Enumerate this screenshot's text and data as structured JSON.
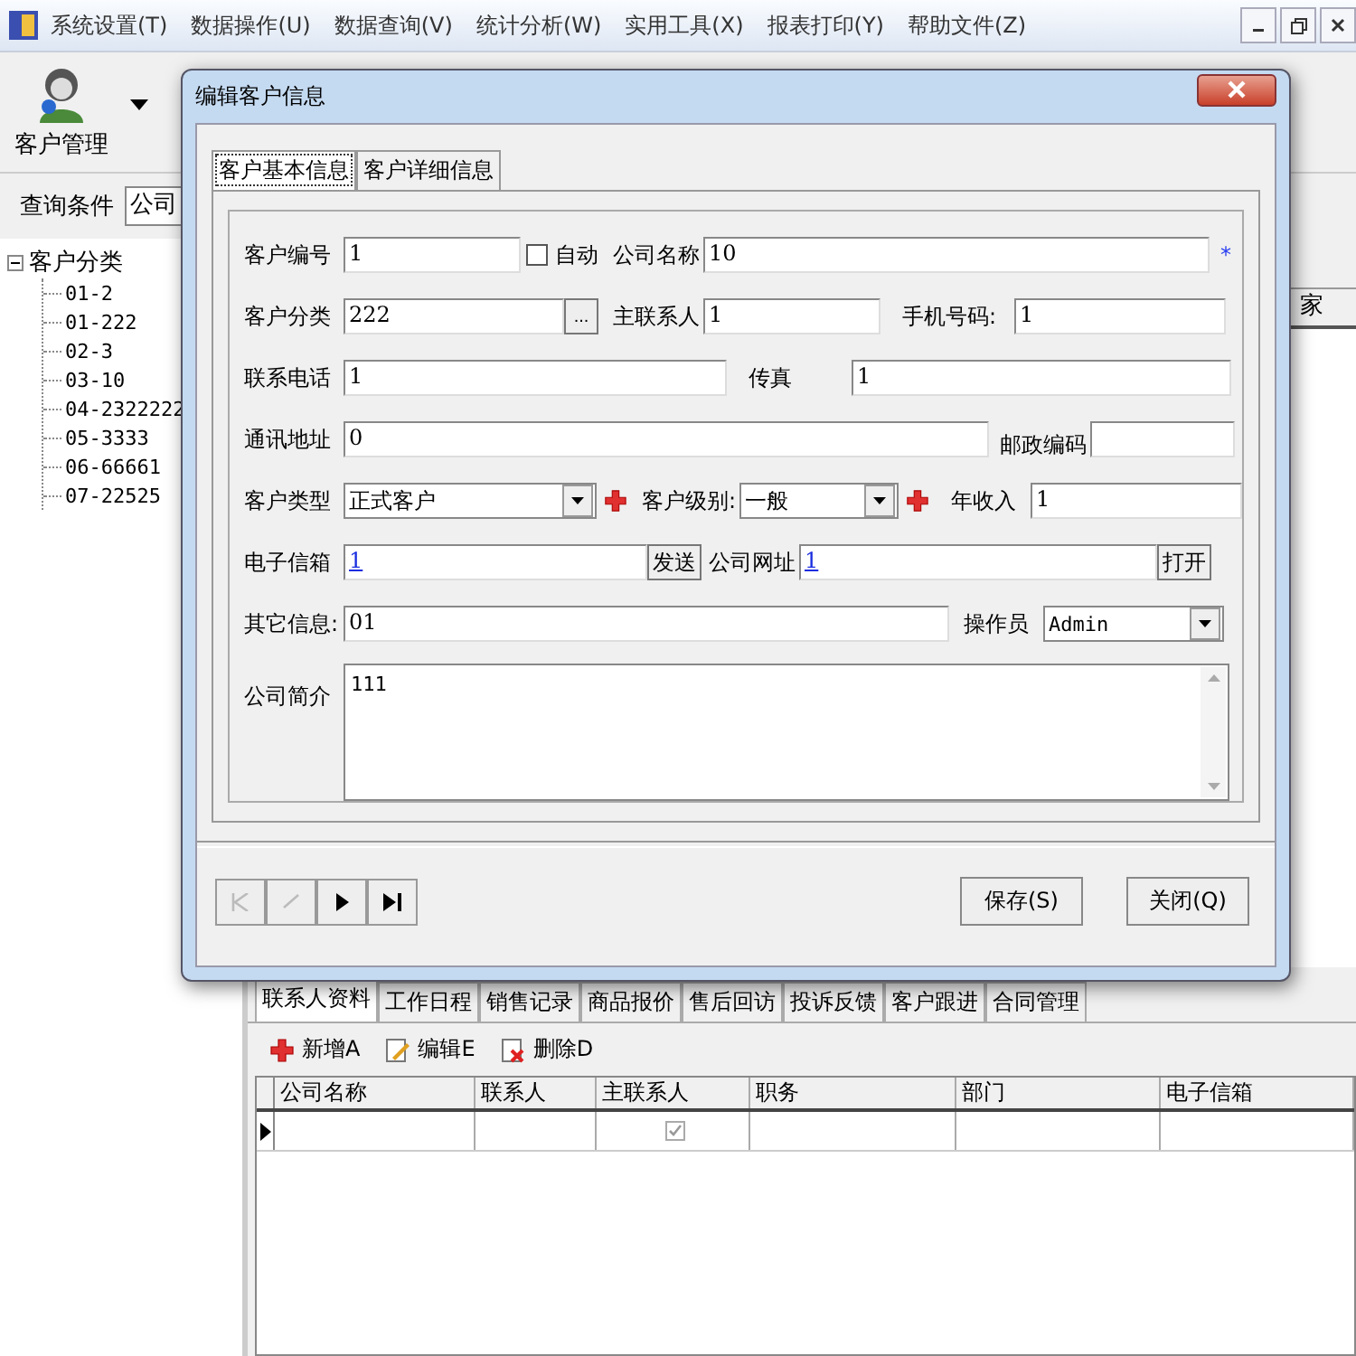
{
  "menu_bar": {
    "items": [
      "系统设置(T)",
      "数据操作(U)",
      "数据查询(V)",
      "统计分析(W)",
      "实用工具(X)",
      "报表打印(Y)",
      "帮助文件(Z)"
    ]
  },
  "toolbar": {
    "items": [
      {
        "label": "客户管理"
      }
    ]
  },
  "query": {
    "label": "查询条件",
    "value": "公司"
  },
  "tree": {
    "label": "客户分类",
    "expanded": true,
    "children": [
      {
        "label": "01-2"
      },
      {
        "label": "01-222"
      },
      {
        "label": "02-3"
      },
      {
        "label": "03-10"
      },
      {
        "label": "04-2322222"
      },
      {
        "label": "05-3333"
      },
      {
        "label": "06-66661"
      },
      {
        "label": "07-22525"
      }
    ]
  },
  "main_grid": {
    "columns": [
      "家"
    ]
  },
  "dialog": {
    "title": "编辑客户信息",
    "tabs": [
      {
        "label": "客户基本信息",
        "selected": true
      },
      {
        "label": "客户详细信息",
        "selected": false
      }
    ],
    "form": {
      "customer_no": {
        "label": "客户编号",
        "value": "1"
      },
      "auto": {
        "label": "自动",
        "checked": false
      },
      "company_name": {
        "label": "公司名称",
        "value": "10",
        "required_mark": "*"
      },
      "category": {
        "label": "客户分类",
        "value": "222",
        "button": "..."
      },
      "main_contact": {
        "label": "主联系人",
        "value": "1"
      },
      "mobile": {
        "label": "手机号码:",
        "value": "1"
      },
      "phone": {
        "label": "联系电话",
        "value": "1"
      },
      "fax": {
        "label": "传真",
        "value": "1"
      },
      "address": {
        "label": "通讯地址",
        "value": "0"
      },
      "postcode": {
        "label": "邮政编码"
      },
      "customer_type": {
        "label": "客户类型",
        "value": "正式客户"
      },
      "level": {
        "label": "客户级别:",
        "value": "一般"
      },
      "income": {
        "label": "年收入",
        "value": "1"
      },
      "email": {
        "label": "电子信箱",
        "value": "1",
        "button": "发送"
      },
      "website": {
        "label": "公司网址",
        "value": "1",
        "button": "打开"
      },
      "other": {
        "label": "其它信息:",
        "value": "01"
      },
      "operator": {
        "label": "操作员",
        "value": "Admin"
      },
      "intro": {
        "label": "公司简介",
        "value": "111"
      }
    },
    "nav_buttons": [
      {
        "kind": "first",
        "disabled": true
      },
      {
        "kind": "prev",
        "disabled": true
      },
      {
        "kind": "next",
        "disabled": false
      },
      {
        "kind": "last",
        "disabled": false
      }
    ],
    "buttons": [
      "保存(S)",
      "关闭(Q)"
    ]
  },
  "bottom": {
    "tabs": [
      {
        "label": "联系人资料",
        "selected": true
      },
      {
        "label": "工作日程",
        "selected": false
      },
      {
        "label": "销售记录",
        "selected": false
      },
      {
        "label": "商品报价",
        "selected": false
      },
      {
        "label": "售后回访",
        "selected": false
      },
      {
        "label": "投诉反馈",
        "selected": false
      },
      {
        "label": "客户跟进",
        "selected": false
      },
      {
        "label": "合同管理",
        "selected": false
      }
    ],
    "actions": [
      {
        "kind": "add",
        "label": "新增A"
      },
      {
        "kind": "edit",
        "label": "编辑E"
      },
      {
        "kind": "delete",
        "label": "删除D"
      }
    ],
    "grid": {
      "columns": [
        "公司名称",
        "联系人",
        "主联系人",
        "职务",
        "部门",
        "电子信箱"
      ],
      "rows": [
        {
          "current": true,
          "main_contact": true
        }
      ]
    }
  }
}
